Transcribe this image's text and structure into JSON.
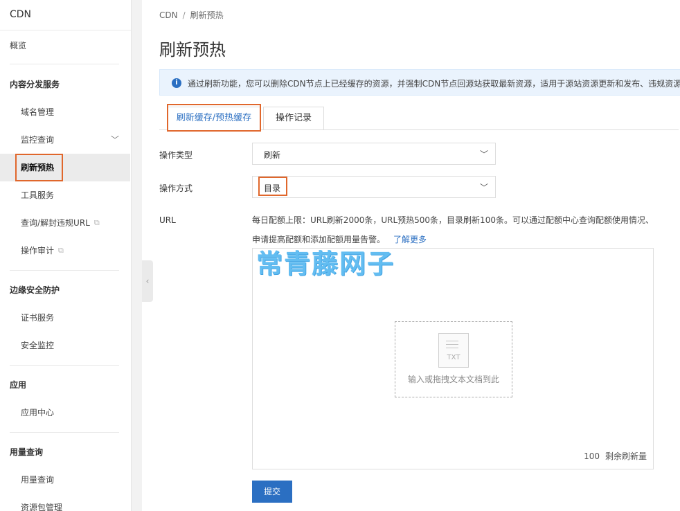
{
  "sidebar": {
    "title": "CDN",
    "overview": "概览",
    "groups": {
      "content": "内容分发服务",
      "edge": "边缘安全防护",
      "apps": "应用",
      "usage": "用量查询"
    },
    "items": {
      "domain": "域名管理",
      "monitor": "监控查询",
      "refresh": "刷新预热",
      "tools": "工具服务",
      "query_url": "查询/解封违规URL",
      "audit": "操作审计",
      "cert": "证书服务",
      "security": "安全监控",
      "app_center": "应用中心",
      "usage_query": "用量查询",
      "package": "资源包管理"
    }
  },
  "breadcrumb": {
    "root": "CDN",
    "sep": "/",
    "current": "刷新预热"
  },
  "page_title": "刷新预热",
  "notice": "通过刷新功能，您可以删除CDN节点上已经缓存的资源，并强制CDN节点回源站获取最新资源，适用于源站资源更新和发布、违规资源清理",
  "tabs": {
    "refresh": "刷新缓存/预热缓存",
    "records": "操作记录"
  },
  "form": {
    "op_type_label": "操作类型",
    "op_type_value": "刷新",
    "op_method_label": "操作方式",
    "op_method_value": "目录",
    "url_label": "URL",
    "quota_text": "每日配额上限：URL刷新2000条，URL预热500条，目录刷新100条。可以通过配额中心查询配额使用情况、申请提高配额和添加配额用量告警。",
    "learn_more": "了解更多",
    "drop_icon_label": "TXT",
    "drop_hint": "输入或拖拽文本文档到此",
    "remain_count": "100",
    "remain_label": "剩余刷新量",
    "submit": "提交"
  },
  "watermark": "常青藤网子",
  "colors": {
    "accent": "#2b6fc2",
    "highlight": "#e0672c",
    "notice_bg": "#eaf3fd"
  }
}
